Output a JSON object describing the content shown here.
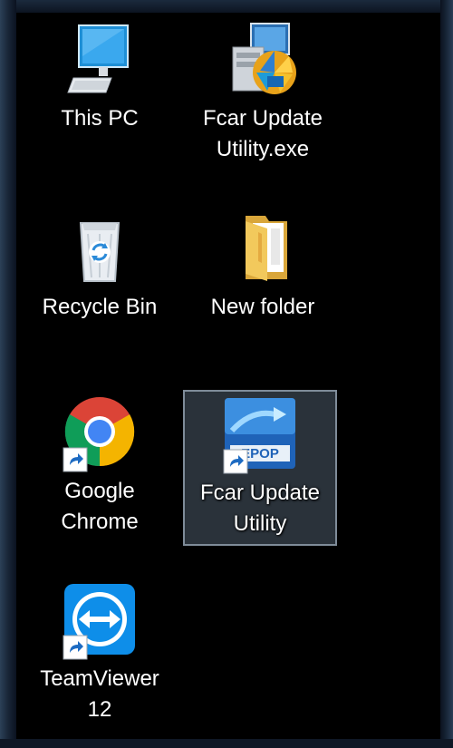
{
  "desktop": {
    "icons": [
      {
        "label": "This PC",
        "icon": "computer-icon"
      },
      {
        "label": "Fcar Update\nUtility.exe",
        "icon": "installer-icon"
      },
      {
        "label": "Recycle Bin",
        "icon": "recycle-bin-icon"
      },
      {
        "label": "New folder",
        "icon": "folder-icon"
      },
      {
        "label": "Google\nChrome",
        "icon": "chrome-icon"
      },
      {
        "label": "Fcar Update\nUtility",
        "icon": "fcar-icon",
        "selected": true
      },
      {
        "label": "TeamViewer\n12",
        "icon": "teamviewer-icon"
      }
    ]
  }
}
